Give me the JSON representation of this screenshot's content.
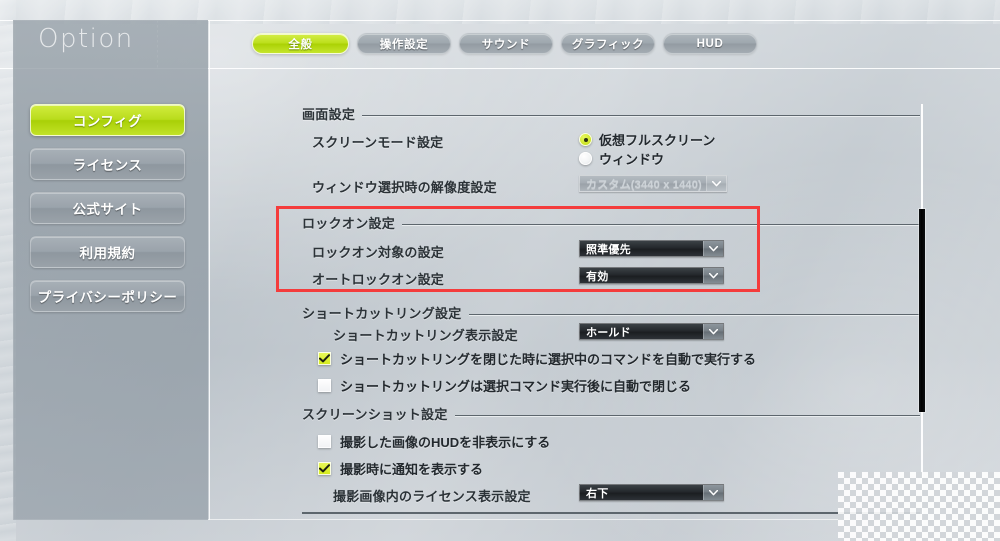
{
  "window": {
    "title": "Option"
  },
  "tabs": [
    {
      "label": "全般",
      "active": true
    },
    {
      "label": "操作設定",
      "active": false
    },
    {
      "label": "サウンド",
      "active": false
    },
    {
      "label": "グラフィック",
      "active": false
    },
    {
      "label": "HUD",
      "active": false
    }
  ],
  "sidebar": {
    "items": [
      {
        "label": "コンフィグ",
        "active": true
      },
      {
        "label": "ライセンス",
        "active": false
      },
      {
        "label": "公式サイト",
        "active": false
      },
      {
        "label": "利用規約",
        "active": false
      },
      {
        "label": "プライバシーポリシー",
        "active": false
      }
    ]
  },
  "sections": {
    "display": {
      "title": "画面設定",
      "screen_mode": {
        "label": "スクリーンモード設定",
        "options": [
          {
            "label": "仮想フルスクリーン",
            "selected": true
          },
          {
            "label": "ウィンドウ",
            "selected": false
          }
        ]
      },
      "resolution": {
        "label": "ウィンドウ選択時の解像度設定",
        "value": "カスタム(3440 x 1440)",
        "disabled": true
      }
    },
    "lockon": {
      "title": "ロックオン設定",
      "target": {
        "label": "ロックオン対象の設定",
        "value": "照準優先"
      },
      "auto": {
        "label": "オートロックオン設定",
        "value": "有効"
      }
    },
    "shortcut_ring": {
      "title": "ショートカットリング設定",
      "display_setting": {
        "label": "ショートカットリング表示設定",
        "value": "ホールド"
      },
      "auto_execute": {
        "label": "ショートカットリングを閉じた時に選択中のコマンドを自動で実行する",
        "checked": true
      },
      "auto_close": {
        "label": "ショートカットリングは選択コマンド実行後に自動で閉じる",
        "checked": false
      }
    },
    "screenshot": {
      "title": "スクリーンショット設定",
      "hide_hud": {
        "label": "撮影した画像のHUDを非表示にする",
        "checked": false
      },
      "notify": {
        "label": "撮影時に通知を表示する",
        "checked": true
      },
      "license_position": {
        "label": "撮影画像内のライセンス表示設定",
        "value": "右下"
      }
    }
  },
  "colors": {
    "accent": "#bcdf1d",
    "highlight": "#f43c3c",
    "panel": "#99a2aa",
    "dropdown_bg": "#24282c"
  }
}
